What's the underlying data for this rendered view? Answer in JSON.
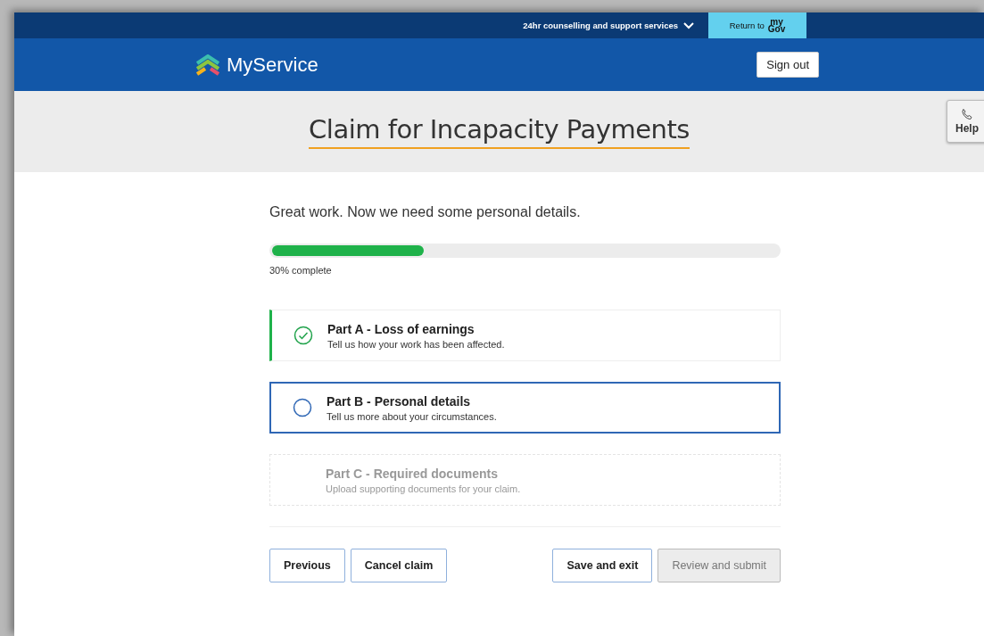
{
  "top_bar": {
    "support_menu": "24hr counselling and support services",
    "return_link": {
      "label": "Return to",
      "logo_top": "my",
      "logo_bottom": "Gov"
    }
  },
  "header": {
    "brand": "MyService",
    "sign_out": "Sign out"
  },
  "title": "Claim for Incapacity Payments",
  "help": {
    "label": "Help"
  },
  "intro": "Great work. Now we need some personal details.",
  "progress": {
    "level": 0.3,
    "label": "30% complete"
  },
  "parts": [
    {
      "kind": "complete",
      "title": "Part A - Loss of earnings",
      "description": "Tell us how your work has been affected."
    },
    {
      "kind": "current",
      "title": "Part B - Personal details",
      "description": "Tell us more about your circumstances."
    },
    {
      "kind": "locked",
      "title": "Part C - Required documents",
      "description": "Upload supporting documents for your claim."
    }
  ],
  "buttons_left": [
    {
      "label": "Previous",
      "disabled": false
    },
    {
      "label": "Cancel claim",
      "disabled": false
    }
  ],
  "buttons_right": [
    {
      "label": "Save and exit",
      "disabled": false
    },
    {
      "label": "Review and submit",
      "disabled": true
    }
  ]
}
